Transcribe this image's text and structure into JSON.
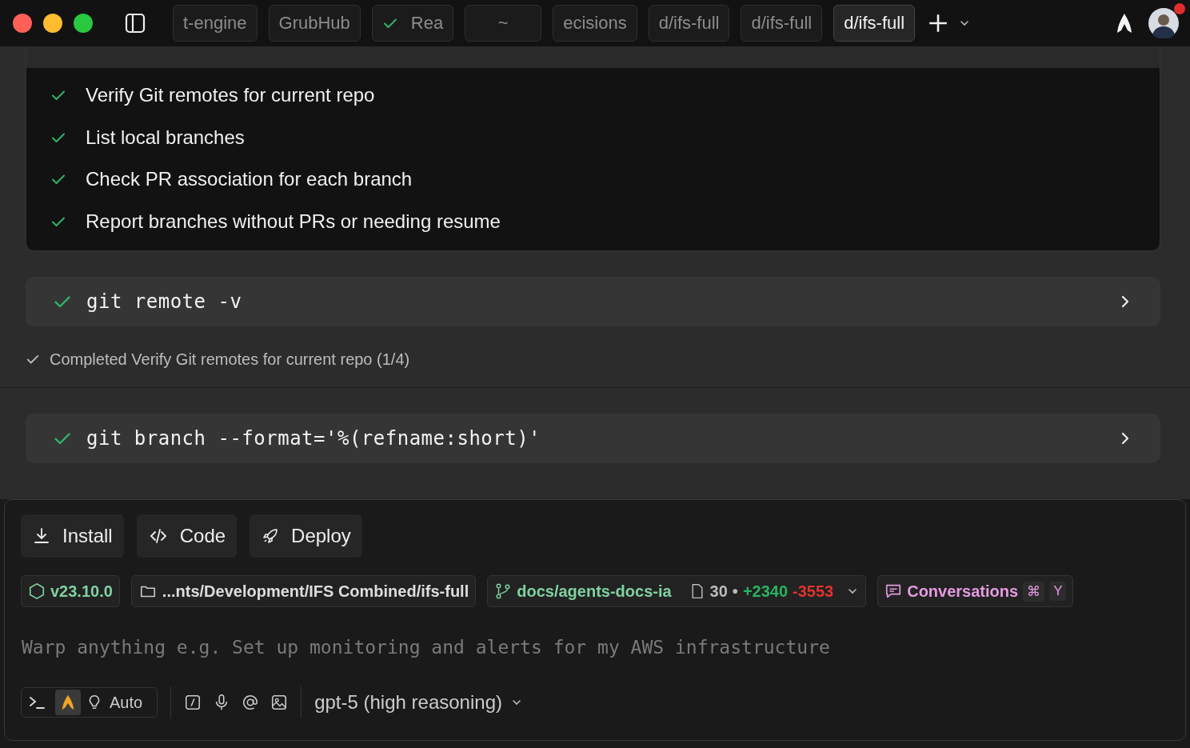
{
  "top_bar": {
    "tabs": [
      {
        "label": "t-engine",
        "selected": false,
        "kind": "plain"
      },
      {
        "label": "GrubHub",
        "selected": false,
        "kind": "plain"
      },
      {
        "label": "Rea",
        "selected": false,
        "kind": "done"
      },
      {
        "label": "~",
        "selected": false,
        "kind": "plain"
      },
      {
        "label": "ecisions",
        "selected": false,
        "kind": "plain"
      },
      {
        "label": "d/ifs-full",
        "selected": false,
        "kind": "plain"
      },
      {
        "label": "d/ifs-full",
        "selected": false,
        "kind": "plain"
      },
      {
        "label": "d/ifs-full",
        "selected": true,
        "kind": "plain"
      }
    ],
    "notification": true
  },
  "tasks": [
    {
      "label": "Verify Git remotes for current repo",
      "checked": true
    },
    {
      "label": "List local branches",
      "checked": true
    },
    {
      "label": "Check PR association for each branch",
      "checked": true
    },
    {
      "label": "Report branches without PRs or needing resume",
      "checked": true
    }
  ],
  "commands": [
    {
      "command": "git remote -v",
      "done": true,
      "note": "Completed Verify Git remotes for current repo (1/4)"
    },
    {
      "command": "git branch --format='%(refname:short)'",
      "done": true
    }
  ],
  "actions": [
    "Install",
    "Code",
    "Deploy"
  ],
  "context": {
    "node_version": "v23.10.0",
    "path": "...nts/Development/IFS Combined/ifs-full",
    "branch": "docs/agents-docs-ia",
    "files": "30",
    "separator": "•",
    "additions": "+2340",
    "deletions": "-3553",
    "conversations": "Conversations",
    "shortcut_keys": [
      "⌘",
      "Y"
    ]
  },
  "input": {
    "placeholder": "Warp anything e.g. Set up monitoring and alerts for my AWS infrastructure"
  },
  "toolbar": {
    "modes": [
      {
        "kind": "terminal",
        "selected": false
      },
      {
        "kind": "agent",
        "selected": true
      }
    ],
    "auto": "Auto",
    "model": "gpt-5 (high reasoning)"
  }
}
